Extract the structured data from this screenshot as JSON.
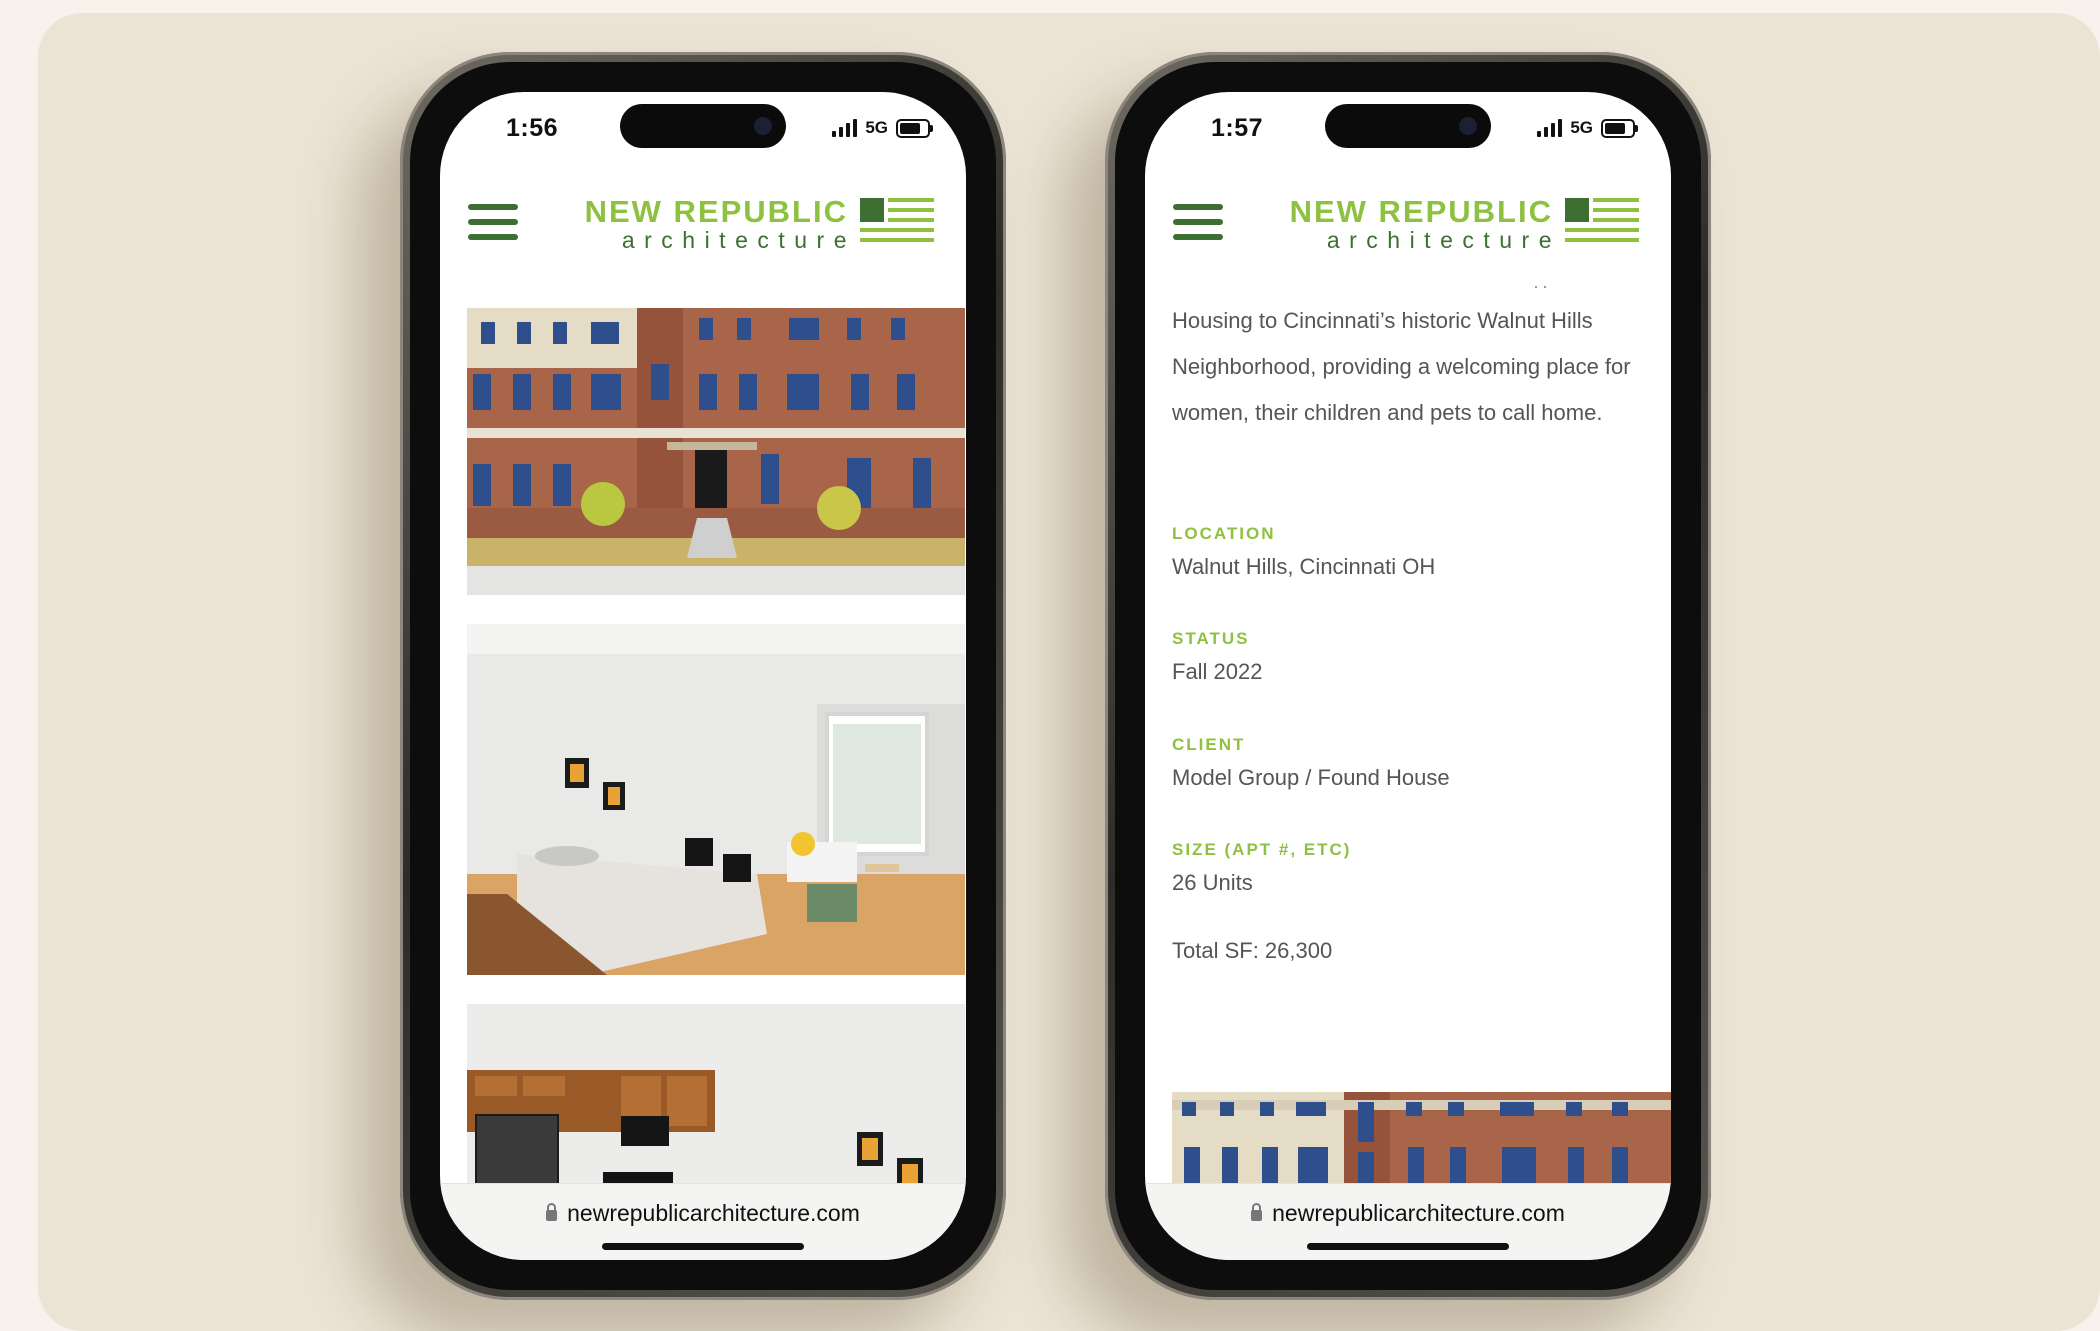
{
  "left_phone": {
    "time": "1:56",
    "network": "5G",
    "url": "newrepublicarchitecture.com"
  },
  "right_phone": {
    "time": "1:57",
    "network": "5G",
    "url": "newrepublicarchitecture.com",
    "intro_lines": [
      "Housing to Cincinnati’s historic Walnut Hills",
      "Neighborhood, providing a welcoming place for",
      "women, their children and pets to call home."
    ],
    "details": {
      "location_label": "LOCATION",
      "location_value": "Walnut Hills, Cincinnati OH",
      "status_label": "STATUS",
      "status_value": "Fall 2022",
      "client_label": "CLIENT",
      "client_value": "Model Group / Found House",
      "size_label": "SIZE (APT #, ETC)",
      "size_value": "26 Units",
      "total_sf": "Total SF: 26,300"
    }
  },
  "logo": {
    "name": "NEW REPUBLIC",
    "sub": "architecture"
  },
  "colors": {
    "brand_light_green": "#8dc13f",
    "brand_dark_green": "#3d6f33",
    "background": "#ebe3d4"
  }
}
